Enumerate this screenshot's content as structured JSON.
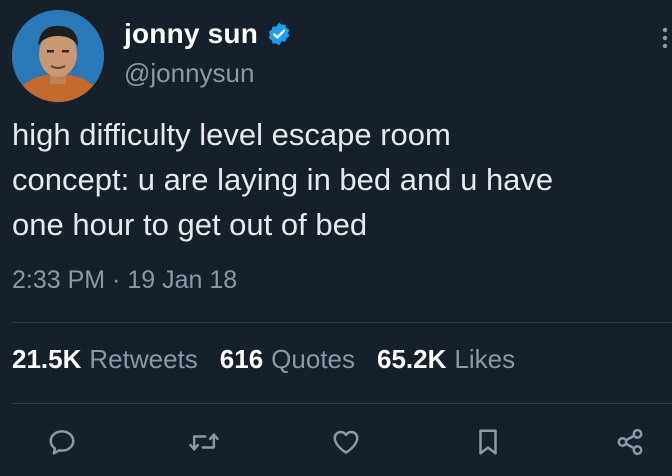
{
  "author": {
    "name": "jonny sun",
    "handle": "@jonnysun",
    "verified_color": "#1d9bf0"
  },
  "tweet": {
    "lines": [
      "high difficulty level escape room",
      "concept: u are laying in bed and u have",
      "one hour to get out of bed"
    ],
    "timestamp": "2:33 PM · 19 Jan 18"
  },
  "stats": {
    "retweets": {
      "count": "21.5K",
      "label": "Retweets"
    },
    "quotes": {
      "count": "616",
      "label": "Quotes"
    },
    "likes": {
      "count": "65.2K",
      "label": "Likes"
    }
  },
  "actions": [
    {
      "icon": "reply-icon"
    },
    {
      "icon": "retweet-icon"
    },
    {
      "icon": "like-icon"
    },
    {
      "icon": "bookmark-icon"
    },
    {
      "icon": "share-icon"
    }
  ],
  "colors": {
    "background": "#15202b",
    "text": "#e7e9ea",
    "secondary": "#8b98a5",
    "divider": "#2f3b47"
  }
}
